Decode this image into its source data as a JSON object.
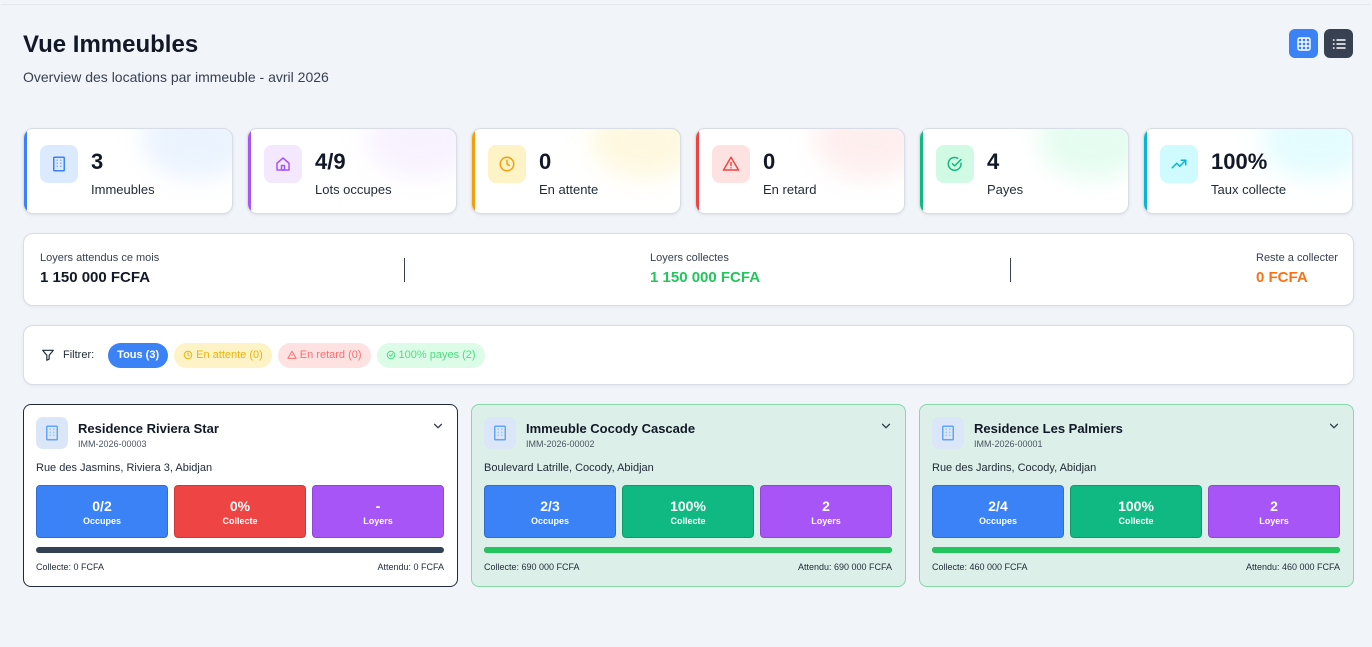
{
  "header": {
    "title": "Vue Immeubles",
    "subtitle": "Overview des locations par immeuble - avril 2026"
  },
  "view_toggle": {
    "grid_icon": "grid-icon",
    "list_icon": "list-icon",
    "active": "grid"
  },
  "stats": [
    {
      "value": "3",
      "label": "Immeubles",
      "icon": "building-icon",
      "color": "#3b82f6",
      "bg": "#dbeafe"
    },
    {
      "value": "4/9",
      "label": "Lots occupes",
      "icon": "home-icon",
      "color": "#a855f7",
      "bg": "#f3e8ff"
    },
    {
      "value": "0",
      "label": "En attente",
      "icon": "clock-icon",
      "color": "#f59e0b",
      "bg": "#fef3c7"
    },
    {
      "value": "0",
      "label": "En retard",
      "icon": "alert-triangle-icon",
      "color": "#ef4444",
      "bg": "#fee2e2"
    },
    {
      "value": "4",
      "label": "Payes",
      "icon": "check-circle-icon",
      "color": "#10b981",
      "bg": "#d1fae5"
    },
    {
      "value": "100%",
      "label": "Taux collecte",
      "icon": "trending-up-icon",
      "color": "#06b6d4",
      "bg": "#cffafe"
    }
  ],
  "summary": {
    "expected_label": "Loyers attendus ce mois",
    "expected_value": "1 150 000 FCFA",
    "collected_label": "Loyers collectes",
    "collected_value": "1 150 000 FCFA",
    "remaining_label": "Reste a collecter",
    "remaining_value": "0 FCFA",
    "colors": {
      "collected": "#22c55e",
      "remaining": "#f97316"
    }
  },
  "filters": {
    "label": "Filtrer:",
    "items": [
      {
        "label": "Tous (3)",
        "kind": "all"
      },
      {
        "label": "En attente (0)",
        "kind": "wait"
      },
      {
        "label": "En retard (0)",
        "kind": "late"
      },
      {
        "label": "100% payes (2)",
        "kind": "paid"
      }
    ]
  },
  "buildings": [
    {
      "name": "Residence Riviera Star",
      "code": "IMM-2026-00003",
      "address": "Rue des Jasmins, Riviera 3, Abidjan",
      "occupied": "0/2",
      "occupied_label": "Occupes",
      "collected_pct": "0%",
      "collected_pct_label": "Collecte",
      "rents": "-",
      "rents_label": "Loyers",
      "progress": 0,
      "footer_collected": "Collecte: 0 FCFA",
      "footer_expected": "Attendu: 0 FCFA",
      "status": "none"
    },
    {
      "name": "Immeuble Cocody Cascade",
      "code": "IMM-2026-00002",
      "address": "Boulevard Latrille, Cocody, Abidjan",
      "occupied": "2/3",
      "occupied_label": "Occupes",
      "collected_pct": "100%",
      "collected_pct_label": "Collecte",
      "rents": "2",
      "rents_label": "Loyers",
      "progress": 100,
      "footer_collected": "Collecte: 690 000 FCFA",
      "footer_expected": "Attendu: 690 000 FCFA",
      "status": "ok"
    },
    {
      "name": "Residence Les Palmiers",
      "code": "IMM-2026-00001",
      "address": "Rue des Jardins, Cocody, Abidjan",
      "occupied": "2/4",
      "occupied_label": "Occupes",
      "collected_pct": "100%",
      "collected_pct_label": "Collecte",
      "rents": "2",
      "rents_label": "Loyers",
      "progress": 100,
      "footer_collected": "Collecte: 460 000 FCFA",
      "footer_expected": "Attendu: 460 000 FCFA",
      "status": "ok"
    }
  ]
}
